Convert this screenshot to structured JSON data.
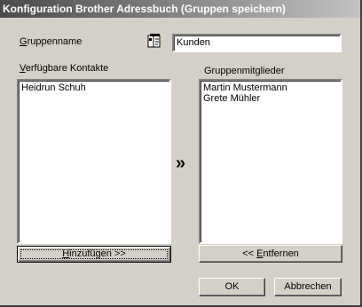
{
  "window": {
    "title": "Konfiguration Brother Adressbuch (Gruppen speichern)"
  },
  "group_name": {
    "label_first": "G",
    "label_rest": "ruppenname",
    "value": "Kunden",
    "icon": "address-book-icon"
  },
  "available_contacts": {
    "label_first": "V",
    "label_rest": "erfügbare Kontakte",
    "items": [
      "Heidrun Schuh"
    ]
  },
  "group_members": {
    "label": "Gruppenmitglieder",
    "items": [
      "Martin Mustermann",
      "Grete Mühler"
    ]
  },
  "arrow": "»",
  "buttons": {
    "add_pre": "",
    "add_ul": "H",
    "add_post": "inzufügen >>",
    "remove_pre": "<< ",
    "remove_ul": "E",
    "remove_post": "ntfernen",
    "ok": "OK",
    "cancel": "Abbrechen"
  }
}
